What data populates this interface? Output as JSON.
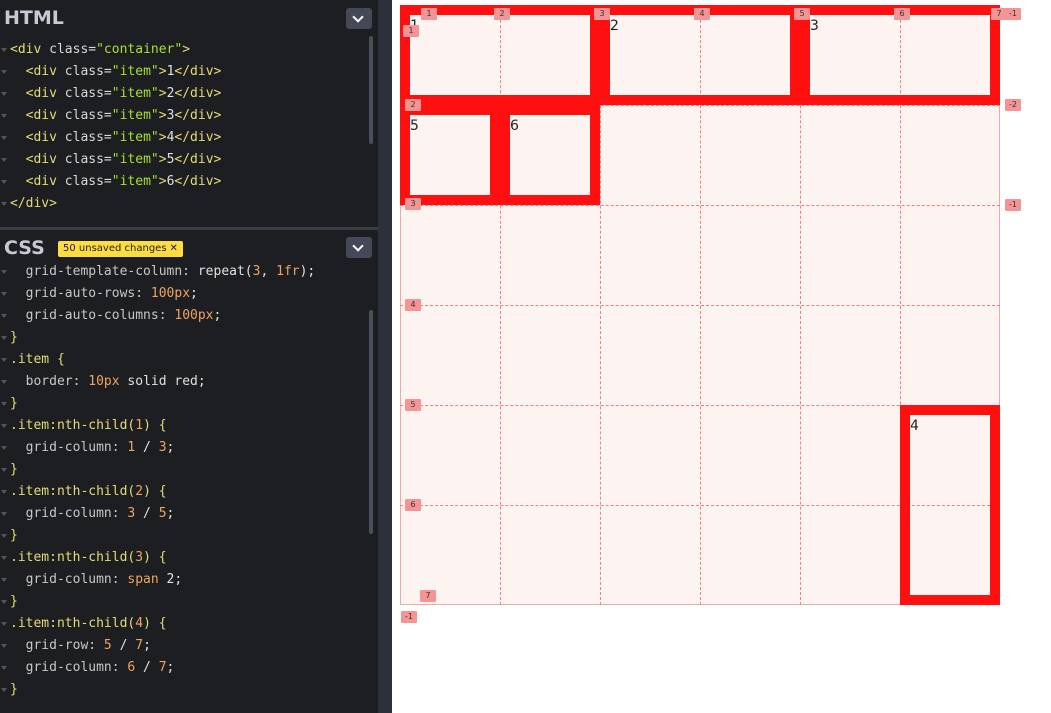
{
  "html_pane": {
    "title": "HTML",
    "lines": [
      {
        "open": "<div ",
        "attr": "class=",
        "val": "\"container\"",
        "close": ">",
        "text": "",
        "end": ""
      },
      {
        "open": "  <div ",
        "attr": "class=",
        "val": "\"item\"",
        "close": ">",
        "text": "1",
        "end": "</div>"
      },
      {
        "open": "  <div ",
        "attr": "class=",
        "val": "\"item\"",
        "close": ">",
        "text": "2",
        "end": "</div>"
      },
      {
        "open": "  <div ",
        "attr": "class=",
        "val": "\"item\"",
        "close": ">",
        "text": "3",
        "end": "</div>"
      },
      {
        "open": "  <div ",
        "attr": "class=",
        "val": "\"item\"",
        "close": ">",
        "text": "4",
        "end": "</div>"
      },
      {
        "open": "  <div ",
        "attr": "class=",
        "val": "\"item\"",
        "close": ">",
        "text": "5",
        "end": "</div>"
      },
      {
        "open": "  <div ",
        "attr": "class=",
        "val": "\"item\"",
        "close": ">",
        "text": "6",
        "end": "</div>"
      },
      {
        "open": "</div>",
        "attr": "",
        "val": "",
        "close": "",
        "text": "",
        "end": ""
      }
    ]
  },
  "css_pane": {
    "title": "CSS",
    "unsaved_label": "50 unsaved changes",
    "lines": [
      [
        "  grid-template-column: ",
        "repeat(",
        "3",
        ", ",
        "1fr",
        ");"
      ],
      [
        "  grid-auto-rows: ",
        "",
        "100px",
        "",
        "",
        ";"
      ],
      [
        "  grid-auto-columns: ",
        "",
        "100px",
        "",
        "",
        ";"
      ],
      [
        "}",
        "",
        "",
        "",
        "",
        ""
      ],
      [
        ".item {",
        "",
        "",
        "",
        "",
        ""
      ],
      [
        "  border: ",
        "",
        "10px",
        " solid red",
        "",
        ";"
      ],
      [
        "}",
        "",
        "",
        "",
        "",
        ""
      ],
      [
        ".item:nth-child(",
        "",
        "1",
        ") {",
        "",
        ""
      ],
      [
        "  grid-column: ",
        "",
        "1",
        " / ",
        "3",
        ";"
      ],
      [
        "}",
        "",
        "",
        "",
        "",
        ""
      ],
      [
        ".item:nth-child(",
        "",
        "2",
        ") {",
        "",
        ""
      ],
      [
        "  grid-column: ",
        "",
        "3",
        " / ",
        "5",
        ";"
      ],
      [
        "}",
        "",
        "",
        "",
        "",
        ""
      ],
      [
        ".item:nth-child(",
        "",
        "3",
        ") {",
        "",
        ""
      ],
      [
        "  grid-column: ",
        "",
        "span ",
        "2",
        "",
        ";"
      ],
      [
        "}",
        "",
        "",
        "",
        "",
        ""
      ],
      [
        ".item:nth-child(",
        "",
        "4",
        ") {",
        "",
        ""
      ],
      [
        "  grid-row: ",
        "",
        "5",
        " / ",
        "7",
        ";"
      ],
      [
        "  grid-column: ",
        "",
        "6",
        " / ",
        "7",
        ";"
      ],
      [
        "}",
        "",
        "",
        "",
        "",
        ""
      ]
    ]
  },
  "preview": {
    "items": [
      "1",
      "2",
      "3",
      "4",
      "5",
      "6"
    ],
    "col_badges": [
      "1",
      "2",
      "3",
      "4",
      "5",
      "6",
      "7",
      "-1"
    ],
    "row_badges": [
      "1",
      "2",
      "3",
      "4",
      "5",
      "6",
      "7",
      "-1"
    ],
    "neg_row_badges": [
      "-2",
      "-1"
    ],
    "neg_col_badge": "-1",
    "colors": {
      "item_border": "#ff1010",
      "grid_bg": "#fdf4f2",
      "badge": "#f49494",
      "editor_bg": "#1d1e22"
    }
  }
}
